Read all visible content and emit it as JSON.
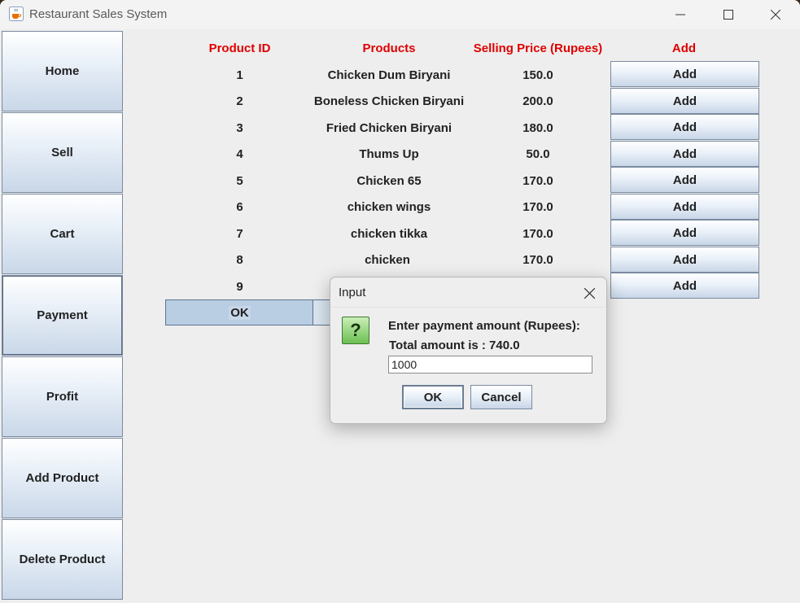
{
  "window": {
    "title": "Restaurant Sales System",
    "icon": "java-cup-icon"
  },
  "sidebar": {
    "items": [
      {
        "label": "Home"
      },
      {
        "label": "Sell"
      },
      {
        "label": "Cart"
      },
      {
        "label": "Payment"
      },
      {
        "label": "Profit"
      },
      {
        "label": "Add Product"
      },
      {
        "label": "Delete Product"
      }
    ]
  },
  "table": {
    "headers": [
      "Product ID",
      "Products",
      "Selling Price (Rupees)",
      "Add"
    ],
    "rows": [
      {
        "id": "1",
        "product": "Chicken Dum Biryani",
        "price": "150.0",
        "action": "Add"
      },
      {
        "id": "2",
        "product": "Boneless Chicken Biryani",
        "price": "200.0",
        "action": "Add"
      },
      {
        "id": "3",
        "product": "Fried Chicken Biryani",
        "price": "180.0",
        "action": "Add"
      },
      {
        "id": "4",
        "product": "Thums Up",
        "price": "50.0",
        "action": "Add"
      },
      {
        "id": "5",
        "product": "Chicken 65",
        "price": "170.0",
        "action": "Add"
      },
      {
        "id": "6",
        "product": "chicken wings",
        "price": "170.0",
        "action": "Add"
      },
      {
        "id": "7",
        "product": "chicken tikka",
        "price": "170.0",
        "action": "Add"
      },
      {
        "id": "8",
        "product": "chicken",
        "price": "170.0",
        "action": "Add"
      },
      {
        "id": "9",
        "product": "",
        "price": "",
        "action": "Add"
      }
    ],
    "ok_label": "OK"
  },
  "dialog": {
    "title": "Input",
    "message": "Enter payment amount (Rupees):",
    "total_text": "Total amount is : 740.0",
    "input_value": "1000",
    "ok_label": "OK",
    "cancel_label": "Cancel",
    "icon": "question-icon",
    "icon_glyph": "?"
  },
  "colors": {
    "header_text": "#e00000",
    "button_gradient_end": "#c8d6e7"
  }
}
